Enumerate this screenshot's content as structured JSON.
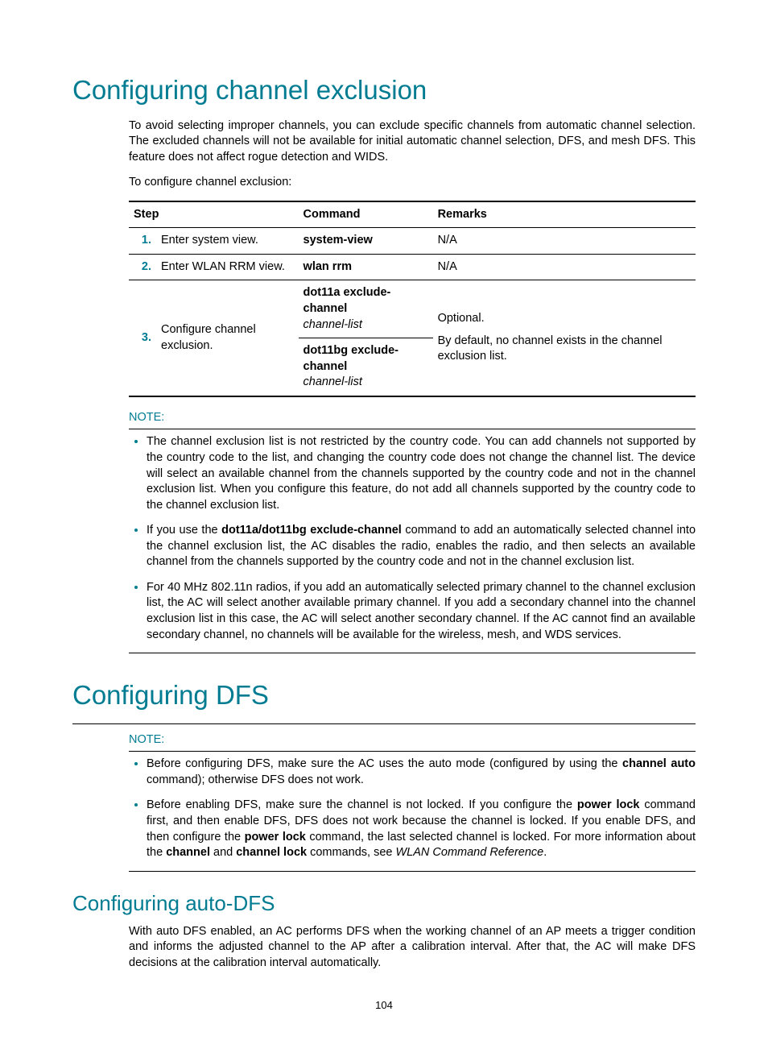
{
  "h1a": "Configuring channel exclusion",
  "para1": "To avoid selecting improper channels, you can exclude specific channels from automatic channel selection. The excluded channels will not be available for initial automatic channel selection, DFS, and mesh DFS. This feature does not affect rogue detection and WIDS.",
  "para2": "To configure channel exclusion:",
  "th_step": "Step",
  "th_cmd": "Command",
  "th_rem": "Remarks",
  "r1_num": "1.",
  "r1_step": "Enter system view.",
  "r1_cmd": "system-view",
  "r1_rem": "N/A",
  "r2_num": "2.",
  "r2_step": "Enter WLAN RRM view.",
  "r2_cmd": "wlan rrm",
  "r2_rem": "N/A",
  "r3_num": "3.",
  "r3_step": "Configure channel exclusion.",
  "r3_cmd1a": "dot11a exclude-channel",
  "r3_cmd1b": "channel-list",
  "r3_cmd2a": "dot11bg exclude-channel",
  "r3_cmd2b": "channel-list",
  "r3_rem1": "Optional.",
  "r3_rem2": "By default, no channel exists in the channel exclusion list.",
  "note_label": "NOTE:",
  "note1": "The channel exclusion list is not restricted by the country code. You can add channels not supported by the country code to the list, and changing the country code does not change the channel list. The device will select an available channel from the channels supported by the country code and not in the channel exclusion list. When you configure this feature, do not add all channels supported by the country code to the channel exclusion list.",
  "note2a": "If you use the ",
  "note2b": "dot11a/dot11bg exclude-channel",
  "note2c": " command to add an automatically selected channel into the channel exclusion list, the AC disables the radio, enables the radio, and then selects an available channel from the channels supported by the country code and not in the channel exclusion list.",
  "note3": "For 40 MHz 802.11n radios, if you add an automatically selected primary channel to the channel exclusion list, the AC will select another available primary channel. If you add a secondary channel into the channel exclusion list in this case, the AC will select another secondary channel. If the AC cannot find an available secondary channel, no channels will be available for the wireless, mesh, and WDS services.",
  "h1b": "Configuring DFS",
  "dfs_n1a": "Before configuring DFS, make sure the AC uses the auto mode (configured by using the ",
  "dfs_n1b": "channel auto",
  "dfs_n1c": " command); otherwise DFS does not work.",
  "dfs_n2a": "Before enabling DFS, make sure the channel is not locked. If you configure the ",
  "dfs_n2b": "power lock",
  "dfs_n2c": " command first, and then enable DFS, DFS does not work because the channel is locked. If you enable DFS, and then configure the ",
  "dfs_n2d": "power lock",
  "dfs_n2e": " command, the last selected channel is locked. For more information about the ",
  "dfs_n2f": "channel",
  "dfs_n2g": " and ",
  "dfs_n2h": "channel lock",
  "dfs_n2i": " commands, see ",
  "dfs_n2j": "WLAN Command Reference",
  "dfs_n2k": ".",
  "h2a": "Configuring auto-DFS",
  "para3": "With auto DFS enabled, an AC performs DFS when the working channel of an AP meets a trigger condition and informs the adjusted channel to the AP after a calibration interval. After that, the AC will make DFS decisions at the calibration interval automatically.",
  "page": "104"
}
